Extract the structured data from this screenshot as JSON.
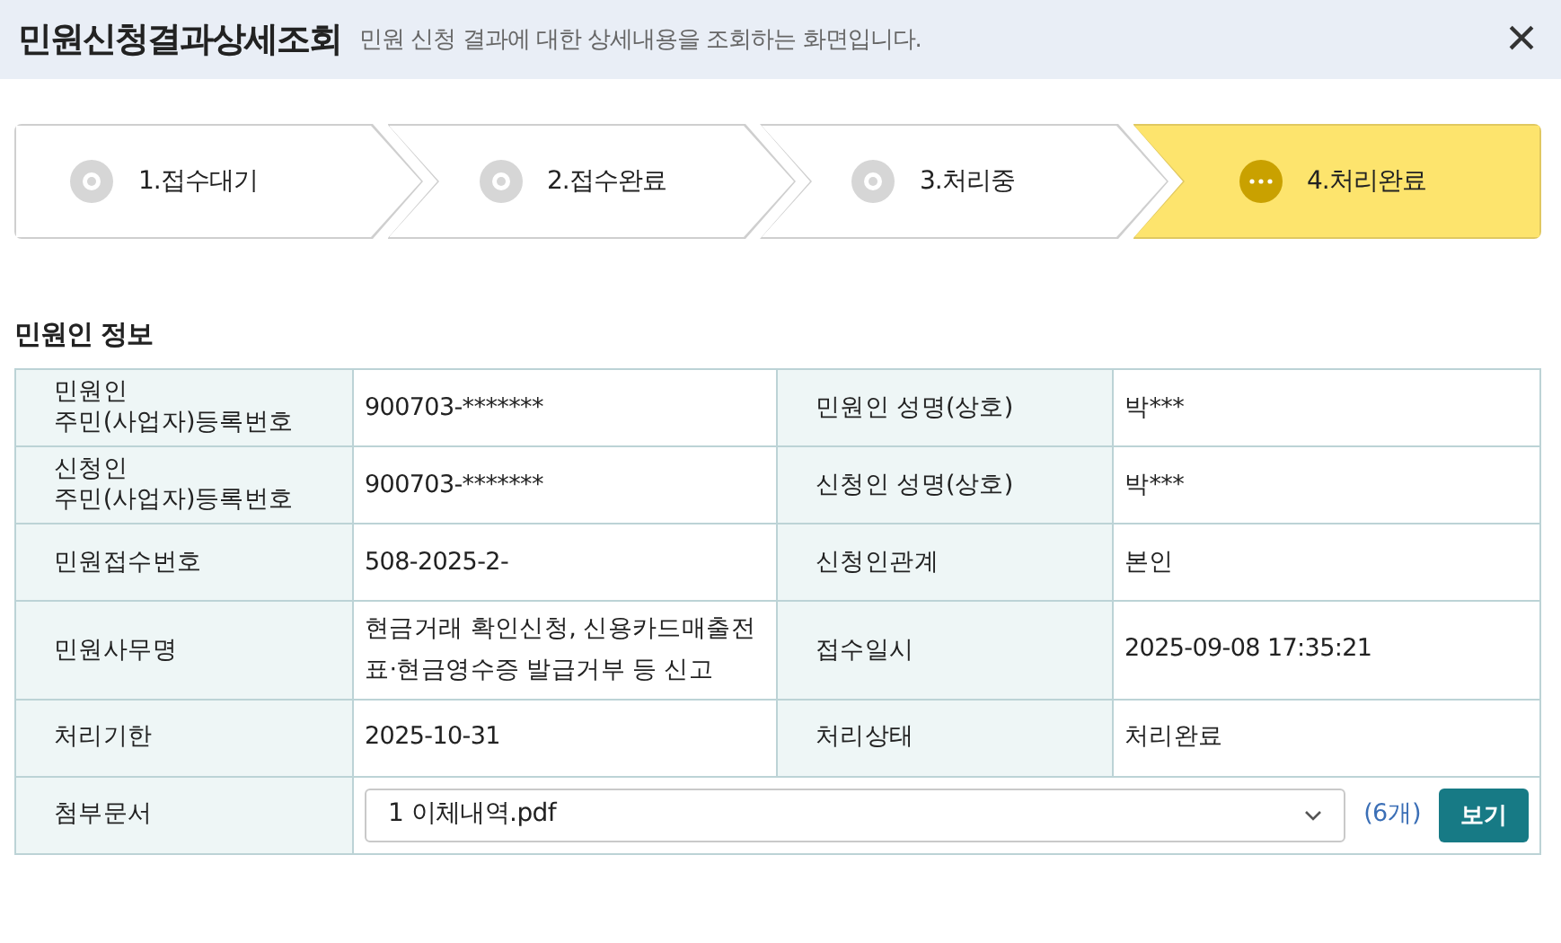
{
  "header": {
    "title": "민원신청결과상세조회",
    "subtitle": "민원 신청 결과에 대한 상세내용을 조회하는 화면입니다.",
    "close": "×"
  },
  "steps": [
    {
      "label": "1.접수대기",
      "selected": false
    },
    {
      "label": "2.접수완료",
      "selected": false
    },
    {
      "label": "3.처리중",
      "selected": false
    },
    {
      "label": "4.처리완료",
      "selected": true
    }
  ],
  "section_title": "민원인 정보",
  "rows": [
    {
      "cells": [
        {
          "label": "민원인\n주민(사업자)등록번호",
          "value": "900703-*******"
        },
        {
          "label": "민원인 성명(상호)",
          "value": "박***"
        }
      ]
    },
    {
      "cells": [
        {
          "label": "신청인\n주민(사업자)등록번호",
          "value": "900703-*******"
        },
        {
          "label": "신청인 성명(상호)",
          "value": "박***"
        }
      ]
    },
    {
      "cells": [
        {
          "label": "민원접수번호",
          "value": "508-2025-2-"
        },
        {
          "label": "신청인관계",
          "value": "본인"
        }
      ]
    },
    {
      "cells": [
        {
          "label": "민원사무명",
          "value": "현금거래 확인신청, 신용카드매출전표·현금영수증 발급거부 등 신고"
        },
        {
          "label": "접수일시",
          "value": "2025-09-08 17:35:21"
        }
      ]
    },
    {
      "cells": [
        {
          "label": "처리기한",
          "value": "2025-10-31"
        },
        {
          "label": "처리상태",
          "value": "처리완료"
        }
      ]
    }
  ],
  "attachments": {
    "label": "첨부문서",
    "selected_file": "1 이체내역.pdf",
    "count": "(6개)",
    "button": "보기"
  }
}
